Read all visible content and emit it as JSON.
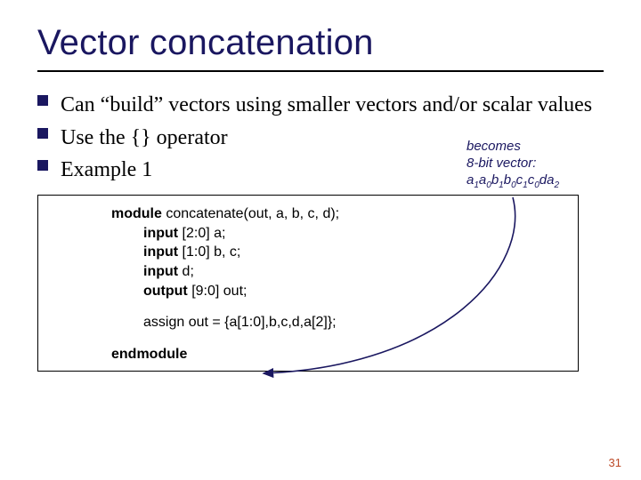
{
  "title": "Vector concatenation",
  "bullets": [
    "Can “build” vectors using smaller vectors and/or scalar values",
    "Use the {} operator",
    "Example 1"
  ],
  "annotation": {
    "line1": "becomes",
    "line2": "8-bit vector:",
    "vec": [
      {
        "t": "a",
        "s": "1"
      },
      {
        "t": "a",
        "s": "0"
      },
      {
        "t": "b",
        "s": "1"
      },
      {
        "t": "b",
        "s": "0"
      },
      {
        "t": "c",
        "s": "1"
      },
      {
        "t": "c",
        "s": "0"
      },
      {
        "t": "d",
        "s": ""
      },
      {
        "t": "a",
        "s": "2"
      }
    ]
  },
  "code": {
    "l1_kw": "module",
    "l1_rest": " concatenate(out, a, b, c, d);",
    "l2_kw": "input",
    "l2_rest": " [2:0] a;",
    "l3_kw": "input",
    "l3_rest": " [1:0] b, c;",
    "l4_kw": "input",
    "l4_rest": " d;",
    "l5_kw": "output",
    "l5_rest": " [9:0] out;",
    "l6": "assign out = {a[1:0],b,c,d,a[2]};",
    "l7_kw": "endmodule"
  },
  "page_num": "31"
}
